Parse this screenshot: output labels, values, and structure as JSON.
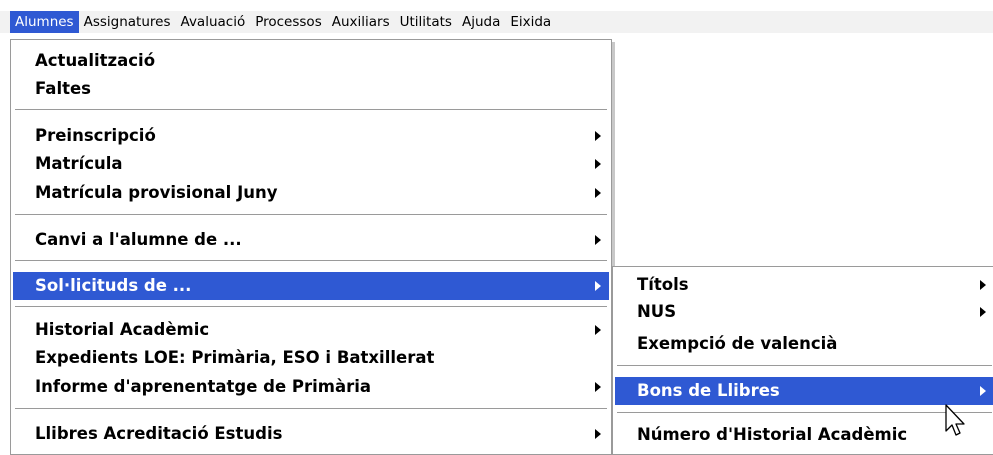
{
  "menubar": {
    "items": [
      "Alumnes",
      "Assignatures",
      "Avaluació",
      "Processos",
      "Auxiliars",
      "Utilitats",
      "Ajuda",
      "Eixida"
    ]
  },
  "main_menu": {
    "items": [
      {
        "label": "Actualització",
        "submenu": false
      },
      {
        "label": "Faltes",
        "submenu": false
      },
      {
        "label": "Preinscripció",
        "submenu": true
      },
      {
        "label": "Matrícula",
        "submenu": true
      },
      {
        "label": "Matrícula provisional Juny",
        "submenu": true
      },
      {
        "label": "Canvi a l'alumne de ...",
        "submenu": true
      },
      {
        "label": "Sol·licituds de ...",
        "submenu": true,
        "highlighted": true
      },
      {
        "label": "Historial Acadèmic",
        "submenu": true
      },
      {
        "label": "Expedients LOE: Primària, ESO i Batxillerat",
        "submenu": false
      },
      {
        "label": "Informe d'aprenentatge de Primària",
        "submenu": true
      },
      {
        "label": "Llibres Acreditació Estudis",
        "submenu": true
      }
    ]
  },
  "sub_menu": {
    "items": [
      {
        "label": "Títols",
        "submenu": true
      },
      {
        "label": "NUS",
        "submenu": true
      },
      {
        "label": "Exempció de valencià",
        "submenu": false
      },
      {
        "label": "Bons de Llibres",
        "submenu": true,
        "highlighted": true
      },
      {
        "label": "Número d'Historial Acadèmic",
        "submenu": false
      }
    ]
  },
  "colors": {
    "highlight": "#2f59d3",
    "menu_bg": "#ffffff",
    "menubar_bg": "#f2f2f2"
  }
}
